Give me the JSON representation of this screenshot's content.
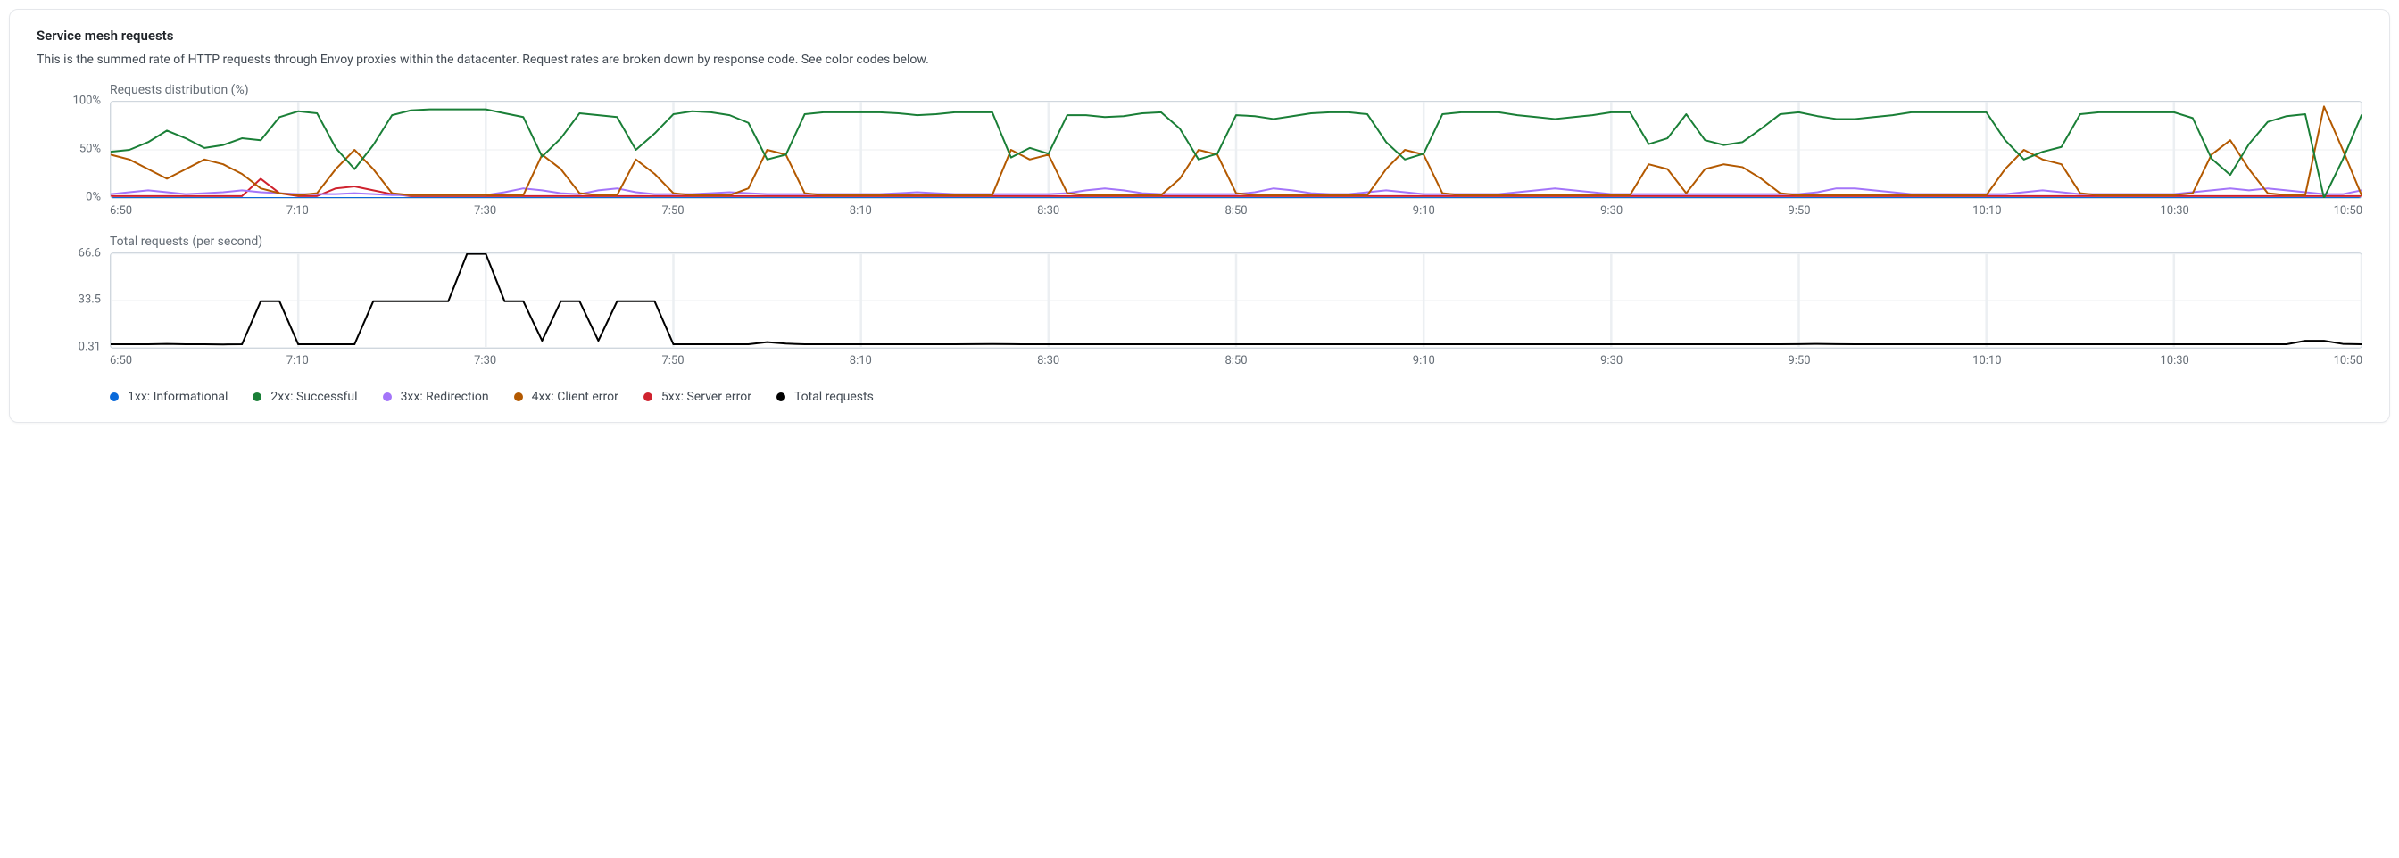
{
  "card": {
    "title": "Service mesh requests",
    "subtitle": "This is the summed rate of HTTP requests through Envoy proxies within the datacenter. Request rates are broken down by response code. See color codes below."
  },
  "legend": [
    {
      "label": "1xx: Informational",
      "color": "#0969da"
    },
    {
      "label": "2xx: Successful",
      "color": "#1a7f37"
    },
    {
      "label": "3xx: Redirection",
      "color": "#a475f9"
    },
    {
      "label": "4xx: Client error",
      "color": "#b35900"
    },
    {
      "label": "5xx: Server error",
      "color": "#cf222e"
    },
    {
      "label": "Total requests",
      "color": "#000000"
    }
  ],
  "chart_data": [
    {
      "type": "line",
      "id": "distribution",
      "title": "Requests distribution (%)",
      "xlabel": "",
      "ylabel": "",
      "ylim": [
        0,
        100
      ],
      "y_ticks": [
        {
          "v": 0,
          "label": "0%"
        },
        {
          "v": 50,
          "label": "50%"
        },
        {
          "v": 100,
          "label": "100%"
        }
      ],
      "x": [
        "6:50",
        "6:52",
        "6:54",
        "6:56",
        "6:58",
        "7:00",
        "7:02",
        "7:04",
        "7:06",
        "7:08",
        "7:10",
        "7:12",
        "7:14",
        "7:16",
        "7:18",
        "7:20",
        "7:22",
        "7:24",
        "7:26",
        "7:28",
        "7:30",
        "7:32",
        "7:34",
        "7:36",
        "7:38",
        "7:40",
        "7:42",
        "7:44",
        "7:46",
        "7:48",
        "7:50",
        "7:52",
        "7:54",
        "7:56",
        "7:58",
        "8:00",
        "8:02",
        "8:04",
        "8:06",
        "8:08",
        "8:10",
        "8:12",
        "8:14",
        "8:16",
        "8:18",
        "8:20",
        "8:22",
        "8:24",
        "8:26",
        "8:28",
        "8:30",
        "8:32",
        "8:34",
        "8:36",
        "8:38",
        "8:40",
        "8:42",
        "8:44",
        "8:46",
        "8:48",
        "8:50",
        "8:52",
        "8:54",
        "8:56",
        "8:58",
        "9:00",
        "9:02",
        "9:04",
        "9:06",
        "9:08",
        "9:10",
        "9:12",
        "9:14",
        "9:16",
        "9:18",
        "9:20",
        "9:22",
        "9:24",
        "9:26",
        "9:28",
        "9:30",
        "9:32",
        "9:34",
        "9:36",
        "9:38",
        "9:40",
        "9:42",
        "9:44",
        "9:46",
        "9:48",
        "9:50",
        "9:52",
        "9:54",
        "9:56",
        "9:58",
        "10:00",
        "10:02",
        "10:04",
        "10:06",
        "10:08",
        "10:10",
        "10:12",
        "10:14",
        "10:16",
        "10:18",
        "10:20",
        "10:22",
        "10:24",
        "10:26",
        "10:28",
        "10:30",
        "10:32",
        "10:34",
        "10:36",
        "10:38",
        "10:40",
        "10:42",
        "10:44",
        "10:46",
        "10:48",
        "10:50"
      ],
      "x_tick_labels": [
        "6:50",
        "7:10",
        "7:30",
        "7:50",
        "8:10",
        "8:30",
        "8:50",
        "9:10",
        "9:30",
        "9:50",
        "10:10",
        "10:30",
        "10:50"
      ],
      "series": [
        {
          "name": "1xx",
          "color": "#0969da",
          "values": [
            0,
            0,
            0,
            0,
            0,
            0,
            0,
            0,
            0,
            0,
            0,
            0,
            0,
            0,
            0,
            0,
            0,
            0,
            0,
            0,
            0,
            0,
            0,
            0,
            0,
            0,
            0,
            0,
            0,
            0,
            0,
            0,
            0,
            0,
            0,
            0,
            0,
            0,
            0,
            0,
            0,
            0,
            0,
            0,
            0,
            0,
            0,
            0,
            0,
            0,
            0,
            0,
            0,
            0,
            0,
            0,
            0,
            0,
            0,
            0,
            0,
            0,
            0,
            0,
            0,
            0,
            0,
            0,
            0,
            0,
            0,
            0,
            0,
            0,
            0,
            0,
            0,
            0,
            0,
            0,
            0,
            0,
            0,
            0,
            0,
            0,
            0,
            0,
            0,
            0,
            0,
            0,
            0,
            0,
            0,
            0,
            0,
            0,
            0,
            0,
            0,
            0,
            0,
            0,
            0,
            0,
            0,
            0,
            0,
            0,
            0,
            0,
            0,
            0,
            0,
            0,
            0,
            0,
            0,
            0,
            0
          ]
        },
        {
          "name": "5xx",
          "color": "#cf222e",
          "values": [
            2,
            2,
            2,
            2,
            2,
            2,
            2,
            2,
            20,
            5,
            2,
            2,
            10,
            12,
            8,
            4,
            2,
            2,
            2,
            2,
            2,
            2,
            2,
            2,
            2,
            2,
            2,
            2,
            2,
            2,
            2,
            2,
            2,
            2,
            2,
            2,
            2,
            2,
            2,
            2,
            2,
            2,
            2,
            2,
            2,
            2,
            2,
            2,
            2,
            2,
            2,
            2,
            2,
            2,
            2,
            2,
            2,
            2,
            2,
            2,
            2,
            2,
            2,
            2,
            2,
            2,
            2,
            2,
            2,
            2,
            2,
            2,
            2,
            2,
            2,
            2,
            2,
            2,
            2,
            2,
            2,
            2,
            2,
            2,
            2,
            2,
            2,
            2,
            2,
            2,
            2,
            2,
            2,
            2,
            2,
            2,
            2,
            2,
            2,
            2,
            2,
            2,
            2,
            2,
            2,
            2,
            2,
            2,
            2,
            2,
            2,
            2,
            2,
            2,
            2,
            2,
            2,
            2,
            2,
            2,
            2
          ]
        },
        {
          "name": "3xx",
          "color": "#a475f9",
          "values": [
            4,
            6,
            8,
            6,
            4,
            5,
            6,
            8,
            6,
            5,
            4,
            4,
            4,
            5,
            4,
            3,
            3,
            3,
            3,
            3,
            3,
            6,
            10,
            8,
            5,
            4,
            8,
            10,
            6,
            4,
            4,
            4,
            5,
            6,
            5,
            4,
            4,
            4,
            4,
            4,
            4,
            4,
            5,
            6,
            5,
            4,
            4,
            4,
            4,
            4,
            4,
            5,
            8,
            10,
            8,
            5,
            4,
            4,
            4,
            4,
            4,
            6,
            10,
            8,
            5,
            4,
            4,
            6,
            8,
            6,
            4,
            4,
            4,
            4,
            4,
            6,
            8,
            10,
            8,
            6,
            4,
            4,
            4,
            4,
            4,
            4,
            4,
            4,
            4,
            4,
            4,
            6,
            10,
            10,
            8,
            6,
            4,
            4,
            4,
            4,
            4,
            4,
            6,
            8,
            6,
            4,
            4,
            4,
            4,
            4,
            4,
            6,
            8,
            10,
            8,
            10,
            8,
            6,
            4,
            4,
            8
          ]
        },
        {
          "name": "4xx",
          "color": "#b35900",
          "values": [
            45,
            40,
            30,
            20,
            30,
            40,
            35,
            25,
            10,
            5,
            3,
            5,
            30,
            50,
            30,
            5,
            3,
            3,
            3,
            3,
            3,
            3,
            3,
            45,
            30,
            5,
            3,
            3,
            40,
            25,
            5,
            3,
            3,
            3,
            10,
            50,
            45,
            5,
            3,
            3,
            3,
            3,
            3,
            3,
            3,
            3,
            3,
            3,
            50,
            40,
            45,
            5,
            3,
            3,
            3,
            3,
            3,
            20,
            50,
            45,
            5,
            3,
            3,
            3,
            3,
            3,
            3,
            3,
            30,
            50,
            45,
            5,
            3,
            3,
            3,
            3,
            3,
            3,
            3,
            3,
            3,
            3,
            35,
            30,
            5,
            30,
            35,
            32,
            20,
            5,
            3,
            3,
            3,
            3,
            3,
            3,
            3,
            3,
            3,
            3,
            3,
            30,
            50,
            40,
            35,
            5,
            3,
            3,
            3,
            3,
            3,
            5,
            45,
            60,
            30,
            5,
            3,
            3,
            95,
            50,
            3
          ]
        },
        {
          "name": "2xx",
          "color": "#1a7f37",
          "values": [
            48,
            50,
            58,
            70,
            62,
            52,
            55,
            62,
            60,
            84,
            90,
            88,
            52,
            30,
            55,
            86,
            91,
            92,
            92,
            92,
            92,
            88,
            84,
            43,
            62,
            88,
            86,
            84,
            50,
            67,
            87,
            90,
            89,
            86,
            78,
            40,
            45,
            87,
            89,
            89,
            89,
            89,
            88,
            86,
            87,
            89,
            89,
            89,
            42,
            52,
            46,
            86,
            86,
            84,
            85,
            88,
            89,
            72,
            40,
            46,
            86,
            85,
            82,
            85,
            88,
            89,
            89,
            87,
            58,
            40,
            46,
            87,
            89,
            89,
            89,
            86,
            84,
            82,
            84,
            86,
            89,
            89,
            56,
            62,
            87,
            60,
            55,
            58,
            72,
            87,
            89,
            85,
            82,
            82,
            84,
            86,
            89,
            89,
            89,
            89,
            89,
            60,
            40,
            48,
            53,
            87,
            89,
            89,
            89,
            89,
            89,
            83,
            41,
            24,
            56,
            79,
            85,
            87,
            0,
            40,
            86
          ]
        }
      ]
    },
    {
      "type": "line",
      "id": "total",
      "title": "Total requests (per second)",
      "xlabel": "",
      "ylabel": "",
      "ylim": [
        0,
        67
      ],
      "y_ticks": [
        {
          "v": 0.31,
          "label": "0.31"
        },
        {
          "v": 33.5,
          "label": "33.5"
        },
        {
          "v": 66.6,
          "label": "66.6"
        }
      ],
      "x": [
        "6:50",
        "6:52",
        "6:54",
        "6:56",
        "6:58",
        "7:00",
        "7:02",
        "7:04",
        "7:06",
        "7:08",
        "7:10",
        "7:12",
        "7:14",
        "7:16",
        "7:18",
        "7:20",
        "7:22",
        "7:24",
        "7:26",
        "7:28",
        "7:30",
        "7:32",
        "7:34",
        "7:36",
        "7:38",
        "7:40",
        "7:42",
        "7:44",
        "7:46",
        "7:48",
        "7:50",
        "7:52",
        "7:54",
        "7:56",
        "7:58",
        "8:00",
        "8:02",
        "8:04",
        "8:06",
        "8:08",
        "8:10",
        "8:12",
        "8:14",
        "8:16",
        "8:18",
        "8:20",
        "8:22",
        "8:24",
        "8:26",
        "8:28",
        "8:30",
        "8:32",
        "8:34",
        "8:36",
        "8:38",
        "8:40",
        "8:42",
        "8:44",
        "8:46",
        "8:48",
        "8:50",
        "8:52",
        "8:54",
        "8:56",
        "8:58",
        "9:00",
        "9:02",
        "9:04",
        "9:06",
        "9:08",
        "9:10",
        "9:12",
        "9:14",
        "9:16",
        "9:18",
        "9:20",
        "9:22",
        "9:24",
        "9:26",
        "9:28",
        "9:30",
        "9:32",
        "9:34",
        "9:36",
        "9:38",
        "9:40",
        "9:42",
        "9:44",
        "9:46",
        "9:48",
        "9:50",
        "9:52",
        "9:54",
        "9:56",
        "9:58",
        "10:00",
        "10:02",
        "10:04",
        "10:06",
        "10:08",
        "10:10",
        "10:12",
        "10:14",
        "10:16",
        "10:18",
        "10:20",
        "10:22",
        "10:24",
        "10:26",
        "10:28",
        "10:30",
        "10:32",
        "10:34",
        "10:36",
        "10:38",
        "10:40",
        "10:42",
        "10:44",
        "10:46",
        "10:48",
        "10:50"
      ],
      "x_tick_labels": [
        "6:50",
        "7:10",
        "7:30",
        "7:50",
        "8:10",
        "8:30",
        "8:50",
        "9:10",
        "9:30",
        "9:50",
        "10:10",
        "10:30",
        "10:50"
      ],
      "series": [
        {
          "name": "Total",
          "color": "#000000",
          "values": [
            2.5,
            2.5,
            2.5,
            2.8,
            2.5,
            2.5,
            2.4,
            2.5,
            33,
            33,
            2.5,
            2.5,
            2.5,
            2.5,
            33,
            33,
            33,
            33,
            33,
            66.6,
            66.6,
            33,
            33,
            5,
            33,
            33,
            5,
            33,
            33,
            33,
            2.5,
            2.5,
            2.5,
            2.5,
            2.5,
            4,
            3,
            2.5,
            2.5,
            2.5,
            2.5,
            2.5,
            2.5,
            2.5,
            2.5,
            2.5,
            2.6,
            2.7,
            2.6,
            2.5,
            2.5,
            2.5,
            2.5,
            2.5,
            2.5,
            2.5,
            2.5,
            2.5,
            2.5,
            2.5,
            2.5,
            2.5,
            2.5,
            2.5,
            2.5,
            2.5,
            2.5,
            2.5,
            2.5,
            2.5,
            2.5,
            2.5,
            2.5,
            2.5,
            2.5,
            2.5,
            2.5,
            2.5,
            2.5,
            2.5,
            2.5,
            2.5,
            2.5,
            2.5,
            2.5,
            2.5,
            2.5,
            2.5,
            2.5,
            2.5,
            2.6,
            2.8,
            2.6,
            2.5,
            2.5,
            2.5,
            2.5,
            2.5,
            2.5,
            2.5,
            2.5,
            2.5,
            2.5,
            2.5,
            2.5,
            2.5,
            2.5,
            2.5,
            2.5,
            2.5,
            2.5,
            2.5,
            2.5,
            2.5,
            2.5,
            2.5,
            2.5,
            5,
            5,
            2.8,
            2.5
          ]
        }
      ]
    }
  ]
}
